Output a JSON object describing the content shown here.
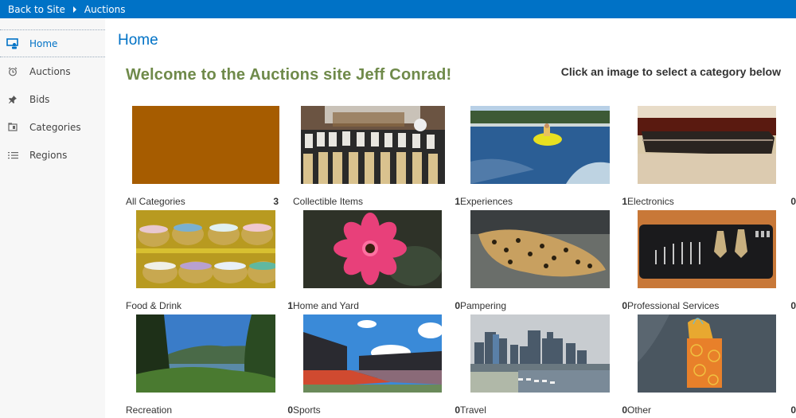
{
  "topbar": {
    "back_label": "Back to Site",
    "current": "Auctions"
  },
  "sidebar": {
    "items": [
      {
        "label": "Home",
        "icon": "home-monitor-icon",
        "selected": true
      },
      {
        "label": "Auctions",
        "icon": "alarm-clock-icon",
        "selected": false
      },
      {
        "label": "Bids",
        "icon": "pushpin-icon",
        "selected": false
      },
      {
        "label": "Categories",
        "icon": "folder-icon",
        "selected": false
      },
      {
        "label": "Regions",
        "icon": "list-icon",
        "selected": false
      }
    ]
  },
  "main": {
    "page_title": "Home",
    "welcome": "Welcome to the Auctions site Jeff Conrad!",
    "hint": "Click an image to select a category below",
    "categories": [
      {
        "label": "All Categories",
        "count": "3",
        "image": "solid-brown-swatch"
      },
      {
        "label": "Collectible Items",
        "count": "1",
        "image": "lego-minifigures-photo"
      },
      {
        "label": "Experiences",
        "count": "1",
        "image": "water-tubing-photo"
      },
      {
        "label": "Electronics",
        "count": "0",
        "image": "laptop-photo"
      },
      {
        "label": "Food & Drink",
        "count": "1",
        "image": "candy-baskets-photo"
      },
      {
        "label": "Home and Yard",
        "count": "0",
        "image": "pink-dahlia-photo"
      },
      {
        "label": "Pampering",
        "count": "0",
        "image": "jaguar-photo"
      },
      {
        "label": "Professional Services",
        "count": "0",
        "image": "tool-kit-photo"
      },
      {
        "label": "Recreation",
        "count": "0",
        "image": "mountain-lake-photo"
      },
      {
        "label": "Sports",
        "count": "0",
        "image": "stadium-photo"
      },
      {
        "label": "Travel",
        "count": "0",
        "image": "city-skyline-photo"
      },
      {
        "label": "Other",
        "count": "0",
        "image": "gift-bag-photo"
      }
    ]
  },
  "colors": {
    "brand_blue": "#0072c6",
    "welcome_green": "#6f8a4a",
    "all_categories_swatch": "#a65c00"
  }
}
